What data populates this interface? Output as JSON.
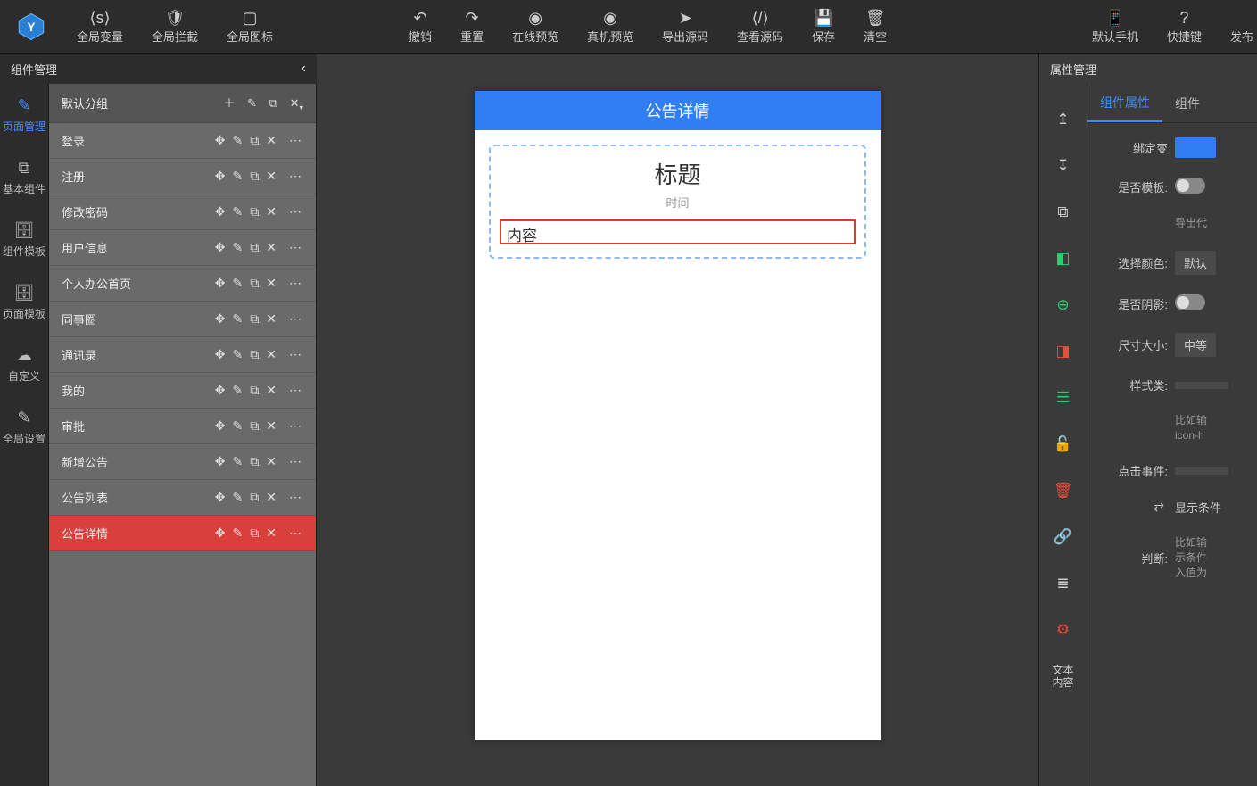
{
  "topbar": {
    "global_var": "全局变量",
    "global_intercept": "全局拦截",
    "global_icon": "全局图标",
    "undo": "撤销",
    "redo": "重置",
    "online_preview": "在线预览",
    "real_preview": "真机预览",
    "export_source": "导出源码",
    "view_source": "查看源码",
    "save": "保存",
    "clear": "清空",
    "default_phone": "默认手机",
    "shortcut": "快捷键",
    "publish": "发布"
  },
  "left_panel": {
    "title": "组件管理",
    "tabs": {
      "page_manage": "页面管理",
      "basic_comp": "基本组件",
      "comp_template": "组件模板",
      "page_template": "页面模板",
      "custom": "自定义",
      "global_setting": "全局设置"
    }
  },
  "page_group": {
    "name": "默认分组",
    "pages": [
      {
        "label": "登录",
        "active": false
      },
      {
        "label": "注册",
        "active": false
      },
      {
        "label": "修改密码",
        "active": false
      },
      {
        "label": "用户信息",
        "active": false
      },
      {
        "label": "个人办公首页",
        "active": false
      },
      {
        "label": "同事圈",
        "active": false
      },
      {
        "label": "通讯录",
        "active": false
      },
      {
        "label": "我的",
        "active": false
      },
      {
        "label": "审批",
        "active": false
      },
      {
        "label": "新增公告",
        "active": false
      },
      {
        "label": "公告列表",
        "active": false
      },
      {
        "label": "公告详情",
        "active": true
      }
    ]
  },
  "canvas": {
    "header": "公告详情",
    "title": "标题",
    "time": "时间",
    "content": "内容"
  },
  "right_panel": {
    "title": "属性管理",
    "tab_component": "组件属性",
    "tab_component2": "组件",
    "bind_var": "绑定变",
    "is_template": "是否模板:",
    "export_code": "导出代",
    "select_color": "选择颜色:",
    "default": "默认",
    "has_shadow": "是否阴影:",
    "size": "尺寸大小:",
    "size_val": "中等",
    "style_class": "样式类:",
    "style_hint": "比如输\nicon-h",
    "click_event": "点击事件:",
    "show_cond": "显示条件",
    "judge": "判断:",
    "judge_hint": "比如输\n示条件\n入值为"
  },
  "right_icons": {
    "text_content": "文本\n内容"
  }
}
